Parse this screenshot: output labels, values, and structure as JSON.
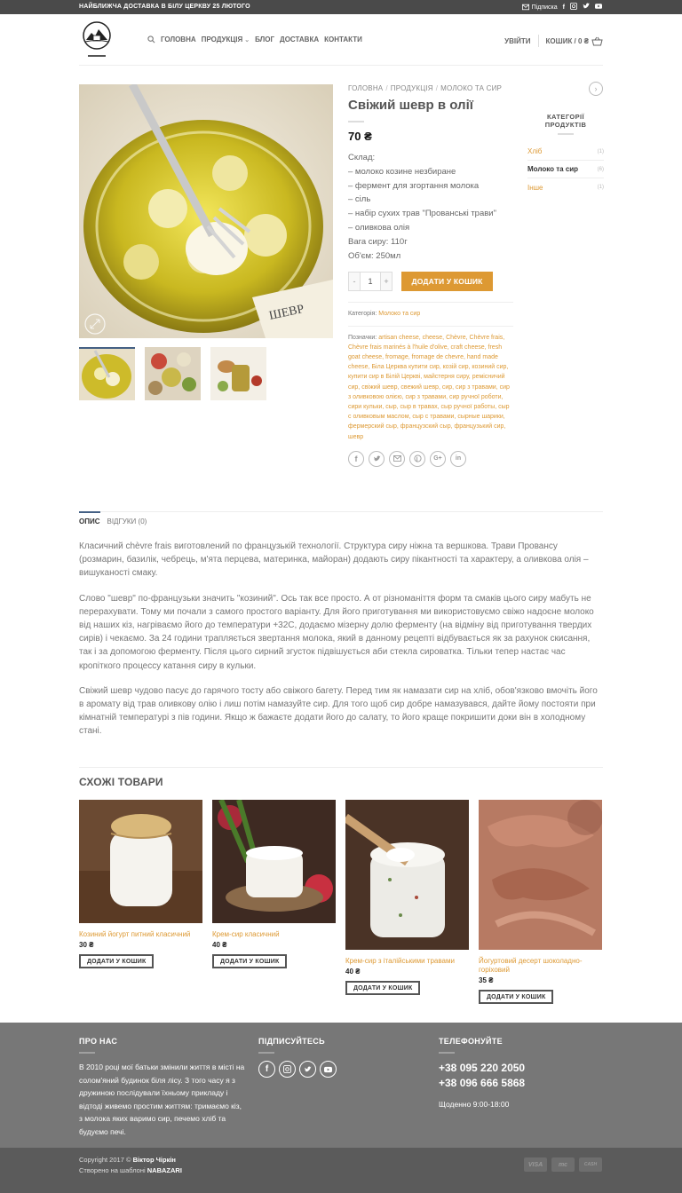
{
  "colors": {
    "accent": "#dd9933",
    "topbar": "#4a4a4a",
    "footer": "#777777",
    "footer_bottom": "#5b5b5b",
    "primary": "#446084"
  },
  "topbar": {
    "promo": "НАЙБЛИЖЧА ДОСТАВКА В БІЛУ ЦЕРКВУ 25 ЛЮТОГО",
    "subscribe": "Підписка"
  },
  "header": {
    "nav": {
      "home": "ГОЛОВНА",
      "products": "ПРОДУКЦІЯ",
      "blog": "БЛОГ",
      "delivery": "ДОСТАВКА",
      "contacts": "КОНТАКТИ"
    },
    "login": "УВІЙТИ",
    "cart": "КОШИК / 0 ₴"
  },
  "breadcrumb": {
    "home": "ГОЛОВНА",
    "products": "ПРОДУКЦІЯ",
    "category": "МОЛОКО ТА СИР"
  },
  "product": {
    "title": "Свіжий шевр в олії",
    "price": "70 ₴",
    "desc": [
      "Склад:",
      "– молоко козине незбиране",
      "– фермент для згортання молока",
      "– сіль",
      "– набір сухих трав \"Прованські трави\"",
      "– оливкова олія",
      "Вага сиру: 110г",
      "Об'єм: 250мл"
    ],
    "qty_minus": "-",
    "qty_value": "1",
    "qty_plus": "+",
    "add_to_cart": "ДОДАТИ У КОШИК",
    "category_label": "Категорія:",
    "category_value": "Молоко та сир",
    "tags_label": "Позначки:",
    "tags": "artisan cheese, cheese, Chèvre, Chèvre frais, Chèvre frais marinés à l'huile d'olive, craft cheese, fresh goat cheese, fromage, fromage de chevre, hand made cheese, Біла Церква купити сир, козій сир, козиний сир, купити сир в Білій Церкві, майстерня сиру, ремісничий сир, свіжий шевр, свежий шевр, сир, сир з травами, сир з оливковою олією, сир з травами, сир ручної роботи, сири кульки, сыр, сыр в травах, сыр ручної работы, сыр с оливковым маслом, сыр с травами, сырные шарики, фермерский сыр, французский сыр, французький сир, шевр"
  },
  "sidebar": {
    "title": "КАТЕГОРІЇ ПРОДУКТІВ",
    "items": [
      {
        "label": "Хліб",
        "count": "(1)"
      },
      {
        "label": "Молоко та сир",
        "count": "(6)"
      },
      {
        "label": "Інше",
        "count": "(1)"
      }
    ]
  },
  "tabs": {
    "description": "ОПИС",
    "reviews": "ВІДГУКИ (0)"
  },
  "content": {
    "p1": "Класичний chèvre frais виготовлений по французькій технології. Структура сиру ніжна та вершкова. Трави Провансу (розмарин, базилік, чебрець, м'ята перцева, материнка, майоран) додають сиру пікантності та характеру, а оливкова олія – вишуканості смаку.",
    "p2": "Слово \"шевр\" по-французьки значить \"козиний\". Ось так все просто. А от різноманіття форм та смаків цього сиру мабуть не перерахувати. Тому ми почали з самого простого варіанту. Для його приготування ми використовуємо свіжо надоєне молоко від наших кіз, нагріваємо його до температури +32С, додаємо мізерну долю ферменту (на відміну від приготування твердих сирів) і чекаємо. За 24 години трапляється звертання молока, який в данному рецепті відбувається як за рахунок скисання, так і за допомогою ферменту. Після цього сирний згусток підвішується аби стекла сироватка. Тільки тепер настає час кропіткого процессу катання сиру в кульки.",
    "p3": "Свіжий шевр чудово пасує до гарячого тосту або свіжого багету. Перед тим як намазати сир на хліб, обов'язково вмочіть його в аромату від трав оливкову олію і лиш потім намазуйте сир. Для того щоб сир добре намазувався, дайте йому постояти при кімнатній температурі з пів години. Якщо ж бажаєте додати його до салату, то його краще покришити доки він в холодному стані."
  },
  "related": {
    "title": "СХОЖІ ТОВАРИ",
    "items": [
      {
        "name": "Козиний йогурт питний класичний",
        "price": "30 ₴",
        "button": "ДОДАТИ У КОШИК"
      },
      {
        "name": "Крем-сир класичний",
        "price": "40 ₴",
        "button": "ДОДАТИ У КОШИК"
      },
      {
        "name": "Крем-сир з італійськими травами",
        "price": "40 ₴",
        "button": "ДОДАТИ У КОШИК"
      },
      {
        "name": "Йогуртовий десерт шоколадно-горіховий",
        "price": "35 ₴",
        "button": "ДОДАТИ У КОШИК"
      }
    ]
  },
  "footer": {
    "about_title": "ПРО НАС",
    "about_text": "В 2010 році мої батьки змінили життя в місті на солом'яний будинок біля лісу. З того часу я з дружиною послідували їхньому прикладу і відтоді живемо простим життям: тримаємо кіз, з молока яких варимо сир, печемо хліб та будуємо печі.",
    "follow_title": "ПІДПИСУЙТЕСЬ",
    "phone_title": "ТЕЛЕФОНУЙТЕ",
    "phone1": "+38 095 220 2050",
    "phone2": "+38 096 666 5868",
    "hours": "Щоденно 9:00-18:00",
    "copyright_prefix": "Copyright 2017 ©",
    "copyright_name": "Віктор Чіркін",
    "created": "Створено на шаблоні",
    "theme": "NABAZARI",
    "cards": [
      "VISA",
      "mc",
      "CASH"
    ]
  }
}
